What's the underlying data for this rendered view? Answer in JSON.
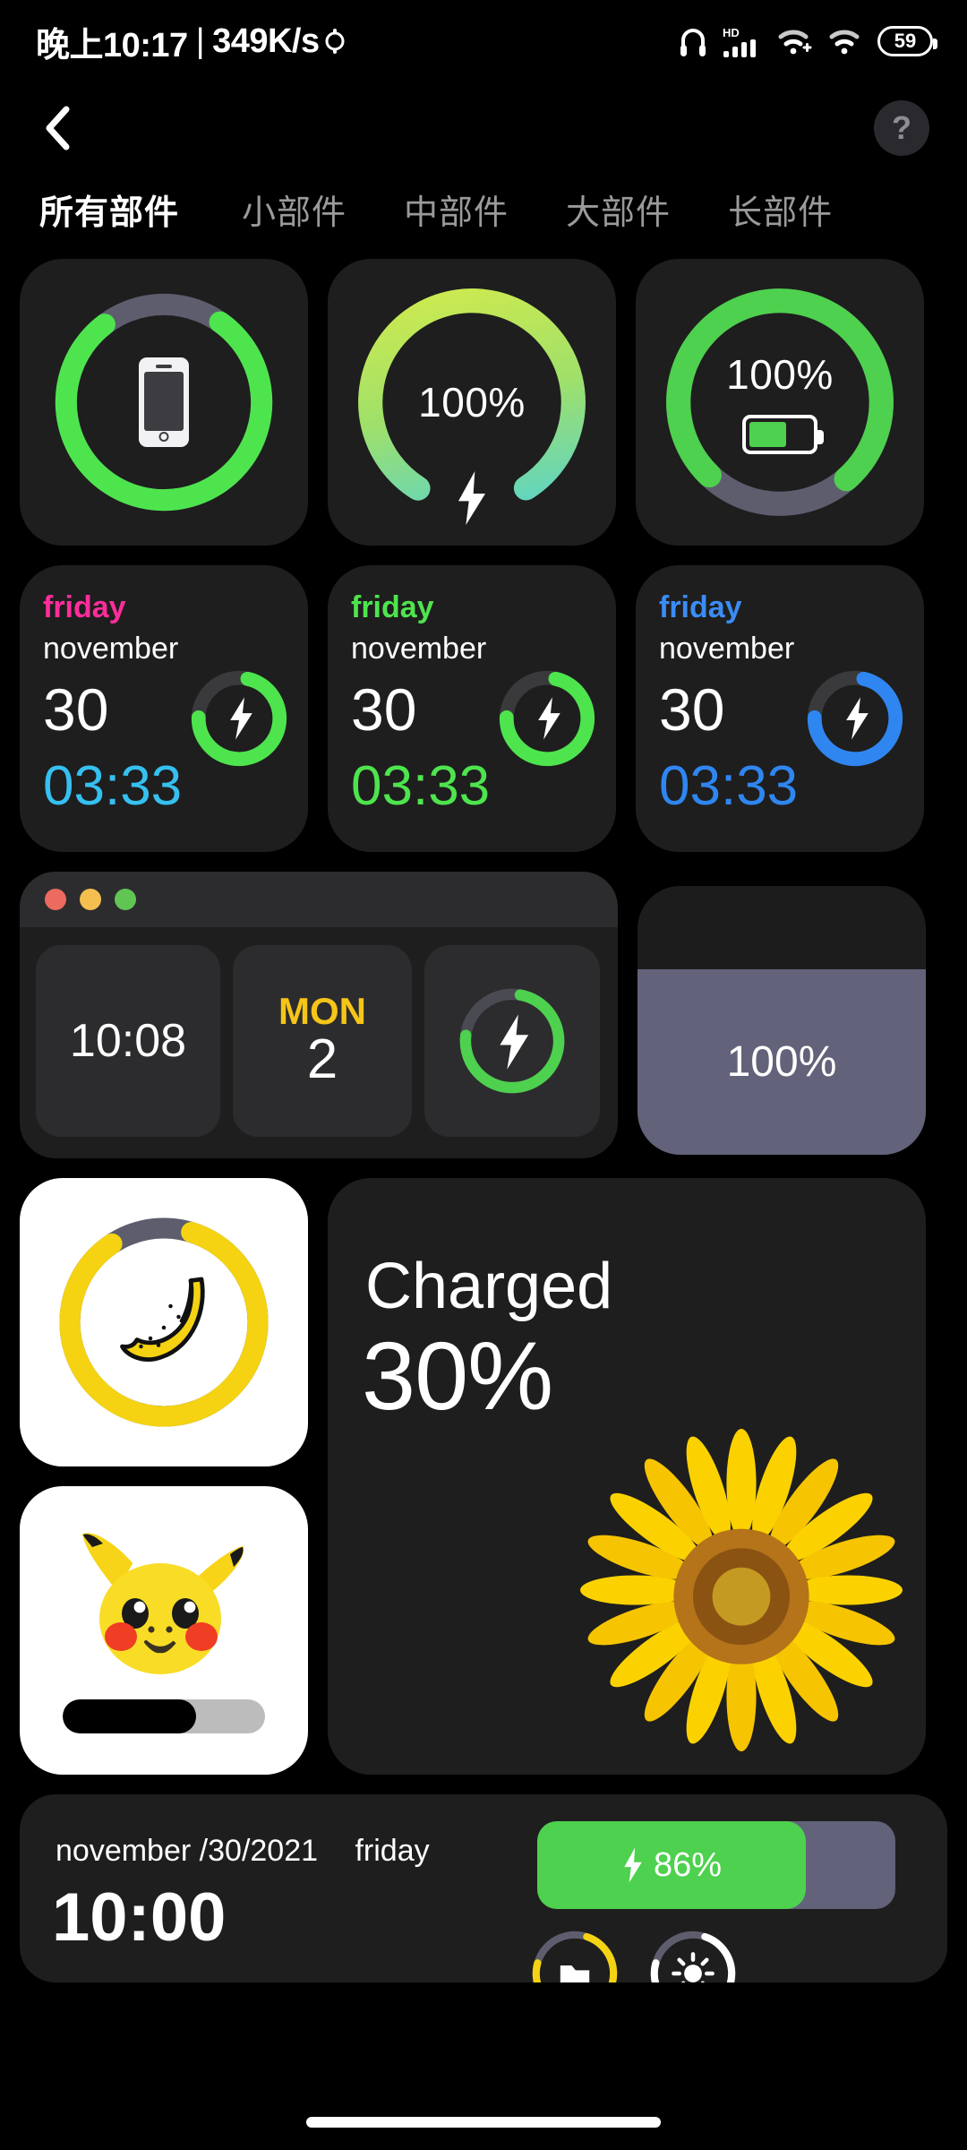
{
  "statusbar": {
    "time": "晚上10:17",
    "separator": "|",
    "netspeed": "349K/s",
    "icons": [
      "headphones-icon",
      "hd-signal-icon",
      "wifi-plus-icon",
      "wifi-icon"
    ],
    "battery_percent": "59"
  },
  "topnav": {
    "back_icon": "chevron-left-icon",
    "help_label": "?"
  },
  "tabs": [
    {
      "label": "所有部件",
      "active": true
    },
    {
      "label": "小部件",
      "active": false
    },
    {
      "label": "中部件",
      "active": false
    },
    {
      "label": "大部件",
      "active": false
    },
    {
      "label": "长部件",
      "active": false
    }
  ],
  "colors": {
    "green": "#4ee44e",
    "green_dark": "#4ed14e",
    "gray_track": "#5d5d6e",
    "blue": "#2f86f0",
    "pink": "#ff2d9b",
    "cyan": "#35c0f0",
    "yellow": "#f5c518",
    "card": "#1e1e1e",
    "purple_gray": "#62627a"
  },
  "row1": [
    {
      "name": "phone-ring-widget",
      "ring_percent": 80,
      "ring_color": "#4ee44e",
      "icon": "phone-icon",
      "label": ""
    },
    {
      "name": "gradient-ring-widget",
      "ring_percent": 82,
      "gradient_from": "#d7ec4a",
      "gradient_to": "#4fd1d9",
      "label": "100%",
      "icon": "bolt-icon"
    },
    {
      "name": "battery-ring-widget",
      "ring_percent": 76,
      "ring_color": "#4ed14e",
      "label": "100%",
      "icon": "battery-icon",
      "battery_fill": 60
    }
  ],
  "row2": [
    {
      "name": "date-widget-pink",
      "day": "friday",
      "day_color": "#ff2d9b",
      "month": "november",
      "date": "30",
      "time": "03:33",
      "time_color": "#35c0f0",
      "ring_color": "#4ee44e",
      "ring_percent": 72,
      "icon": "bolt-icon"
    },
    {
      "name": "date-widget-green",
      "day": "friday",
      "day_color": "#4ee44e",
      "month": "november",
      "date": "30",
      "time": "03:33",
      "time_color": "#4ee44e",
      "ring_color": "#4ee44e",
      "ring_percent": 72,
      "icon": "bolt-icon"
    },
    {
      "name": "date-widget-blue",
      "day": "friday",
      "day_color": "#3b8cf5",
      "month": "november",
      "date": "30",
      "time": "03:33",
      "time_color": "#2f86f0",
      "ring_color": "#2f86f0",
      "ring_percent": 72,
      "icon": "bolt-icon"
    }
  ],
  "mac_widget": {
    "name": "mac-window-widget",
    "dots": [
      "#ec6a5e",
      "#f5bf4f",
      "#61c554"
    ],
    "tile_time": "10:08",
    "tile_dow": "MON",
    "tile_date": "2",
    "ring_percent": 74,
    "ring_color": "#4ed14e",
    "ring_icon": "bolt-icon"
  },
  "fill_widget": {
    "name": "fill-level-widget",
    "label": "100%",
    "fill_percent": 69
  },
  "banana_widget": {
    "name": "banana-ring-widget",
    "ring_percent": 86,
    "ring_color": "#f5d312",
    "icon": "banana-icon"
  },
  "charged_widget": {
    "name": "charged-widget",
    "title": "Charged",
    "percent": "30%",
    "image": "sunflower-image"
  },
  "pikachu_widget": {
    "name": "pikachu-battery-widget",
    "icon": "pikachu-icon",
    "bar_percent": 66
  },
  "long_widget": {
    "name": "long-date-battery-widget",
    "month": "november",
    "slash": "/",
    "day": "30",
    "year": "2021",
    "weekday": "friday",
    "time": "10:00",
    "battery_percent": "86%",
    "battery_fill": 75,
    "battery_icon": "bolt-icon",
    "gauges": [
      {
        "name": "storage-gauge",
        "icon": "folder-icon",
        "color": "#f5d312",
        "percent": 74
      },
      {
        "name": "brightness-gauge",
        "icon": "sun-icon",
        "color": "#ffffff",
        "percent": 74
      }
    ]
  },
  "navbar": {
    "name": "gesture-pill"
  }
}
